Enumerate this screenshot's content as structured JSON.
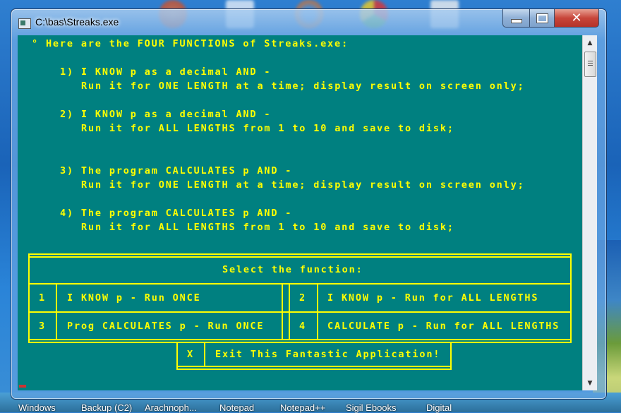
{
  "window": {
    "title": "C:\\bas\\Streaks.exe",
    "controls": {
      "minimize": "minimize",
      "maximize": "maximize",
      "close": "close"
    }
  },
  "console": {
    "colors": {
      "background": "#008080",
      "text": "#ffff00"
    },
    "heading": "° Here are the FOUR FUNCTIONS of Streaks.exe:",
    "functions": [
      {
        "line1": "1) I KNOW p as a decimal AND -",
        "line2": "Run it for ONE LENGTH at a time; display result on screen only;"
      },
      {
        "line1": "2) I KNOW p as a decimal AND -",
        "line2": "Run it for ALL LENGTHS from 1 to 10 and save to disk;"
      },
      {
        "line1": "3) The program CALCULATES p AND -",
        "line2": "Run it for ONE LENGTH at a time; display result on screen only;"
      },
      {
        "line1": "4) The program CALCULATES p AND -",
        "line2": "Run it for ALL LENGTHS from 1 to 10 and save to disk;"
      }
    ],
    "menu": {
      "title": "Select the function:",
      "options": [
        {
          "key": "1",
          "label": "I KNOW p - Run ONCE"
        },
        {
          "key": "2",
          "label": "I KNOW p - Run for ALL LENGTHS"
        },
        {
          "key": "3",
          "label": "Prog CALCULATES p - Run ONCE"
        },
        {
          "key": "4",
          "label": "CALCULATE p - Run for ALL LENGTHS"
        }
      ],
      "exit": {
        "key": "X",
        "label": "Exit This Fantastic Application!"
      }
    }
  },
  "scrollbar": {
    "up": "▲",
    "down": "▼",
    "position_fraction": 0.0
  },
  "taskbar": {
    "items": [
      "Windows",
      "Backup (C2)",
      "Arachnoph...",
      "Notepad",
      "Notepad++",
      "Sigil Ebooks",
      "Digital"
    ]
  },
  "desktop_icons": [
    "icon-orange",
    "icon-document",
    "firefox-icon",
    "chrome-icon",
    "icon-blank-document"
  ]
}
